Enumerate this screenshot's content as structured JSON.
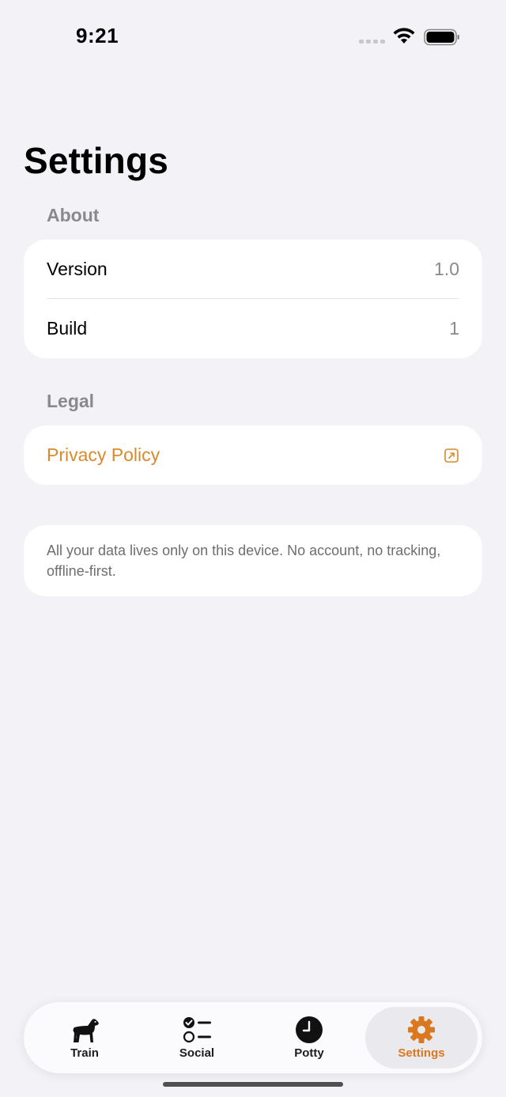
{
  "status_bar": {
    "time": "9:21"
  },
  "page": {
    "title": "Settings"
  },
  "about": {
    "header": "About",
    "rows": [
      {
        "label": "Version",
        "value": "1.0"
      },
      {
        "label": "Build",
        "value": "1"
      }
    ]
  },
  "legal": {
    "header": "Legal",
    "privacy_label": "Privacy Policy",
    "privacy_icon": "external-link-icon"
  },
  "footer": {
    "text": "All your data lives only on this device. No account, no tracking, offline-first."
  },
  "tab_bar": {
    "tabs": [
      {
        "label": "Train",
        "icon": "dog-icon"
      },
      {
        "label": "Social",
        "icon": "checklist-icon"
      },
      {
        "label": "Potty",
        "icon": "clock-icon"
      },
      {
        "label": "Settings",
        "icon": "gear-icon",
        "active": true
      }
    ]
  },
  "colors": {
    "accent": "#d9781f",
    "link": "#d98a2b",
    "background": "#f2f2f7"
  }
}
